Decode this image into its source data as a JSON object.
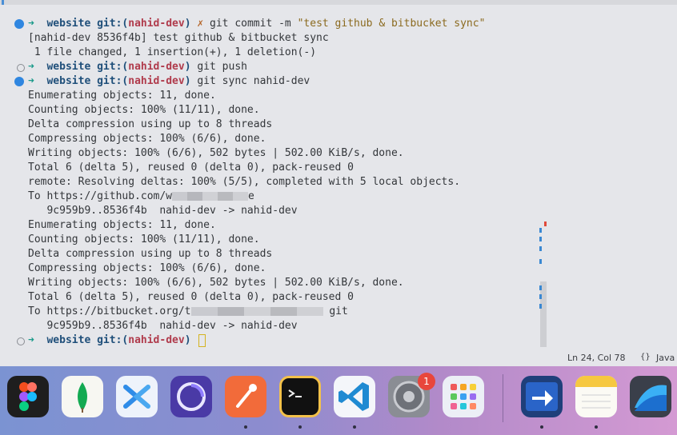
{
  "terminal": {
    "lines": [
      {
        "type": "prompt",
        "marker": "blue",
        "dir": "website",
        "git": "git:(",
        "branch": "nahid-dev",
        "close": ")",
        "x": "✗",
        "cmd": "git commit -m ",
        "str": "\"test github & bitbucket sync\""
      },
      {
        "type": "out",
        "text": "[nahid-dev 8536f4b] test github & bitbucket sync"
      },
      {
        "type": "out",
        "text": " 1 file changed, 1 insertion(+), 1 deletion(-)"
      },
      {
        "type": "prompt",
        "marker": "hollow",
        "dir": "website",
        "git": "git:(",
        "branch": "nahid-dev",
        "close": ")",
        "cmd": "git push"
      },
      {
        "type": "prompt",
        "marker": "blue",
        "dir": "website",
        "git": "git:(",
        "branch": "nahid-dev",
        "close": ")",
        "cmd": "git sync nahid-dev"
      },
      {
        "type": "out",
        "text": "Enumerating objects: 11, done."
      },
      {
        "type": "out",
        "text": "Counting objects: 100% (11/11), done."
      },
      {
        "type": "out",
        "text": "Delta compression using up to 8 threads"
      },
      {
        "type": "out",
        "text": "Compressing objects: 100% (6/6), done."
      },
      {
        "type": "out",
        "text": "Writing objects: 100% (6/6), 502 bytes | 502.00 KiB/s, done."
      },
      {
        "type": "out",
        "text": "Total 6 (delta 5), reused 0 (delta 0), pack-reused 0"
      },
      {
        "type": "out",
        "text": "remote: Resolving deltas: 100% (5/5), completed with 5 local objects."
      },
      {
        "type": "out",
        "text": "To https://github.com/w",
        "blur": 95,
        "tail": "e"
      },
      {
        "type": "out",
        "text": "   9c959b9..8536f4b  nahid-dev -> nahid-dev"
      },
      {
        "type": "out",
        "text": "Enumerating objects: 11, done."
      },
      {
        "type": "out",
        "text": "Counting objects: 100% (11/11), done."
      },
      {
        "type": "out",
        "text": "Delta compression using up to 8 threads"
      },
      {
        "type": "out",
        "text": "Compressing objects: 100% (6/6), done."
      },
      {
        "type": "out",
        "text": "Writing objects: 100% (6/6), 502 bytes | 502.00 KiB/s, done."
      },
      {
        "type": "out",
        "text": "Total 6 (delta 5), reused 0 (delta 0), pack-reused 0"
      },
      {
        "type": "out",
        "text": "To https://bitbucket.org/t",
        "blur": 165,
        "tail": " git"
      },
      {
        "type": "out",
        "text": "   9c959b9..8536f4b  nahid-dev -> nahid-dev"
      },
      {
        "type": "prompt",
        "marker": "hollow",
        "dir": "website",
        "git": "git:(",
        "branch": "nahid-dev",
        "close": ")",
        "cmd": "",
        "cursor": true
      }
    ],
    "arrow": "➜"
  },
  "status": {
    "position": "Ln 24, Col 78",
    "lang_icon": "{}",
    "lang": "Java"
  },
  "dock": {
    "apps": [
      {
        "name": "figma",
        "running": false
      },
      {
        "name": "mongodb-compass",
        "running": false
      },
      {
        "name": "app-3",
        "running": false
      },
      {
        "name": "app-4",
        "running": false
      },
      {
        "name": "postman",
        "running": true
      },
      {
        "name": "terminal",
        "running": true
      },
      {
        "name": "vscode",
        "running": true
      },
      {
        "name": "system-preferences",
        "running": false,
        "badge": "1"
      },
      {
        "name": "launchpad",
        "running": false
      },
      {
        "name": "app-10",
        "running": true
      },
      {
        "name": "notes",
        "running": true
      },
      {
        "name": "app-12",
        "running": false
      }
    ],
    "colors": {
      "accent_blue": "#2f86e0",
      "branch_red": "#b03b4c",
      "dir_blue": "#1f4f7a"
    }
  }
}
